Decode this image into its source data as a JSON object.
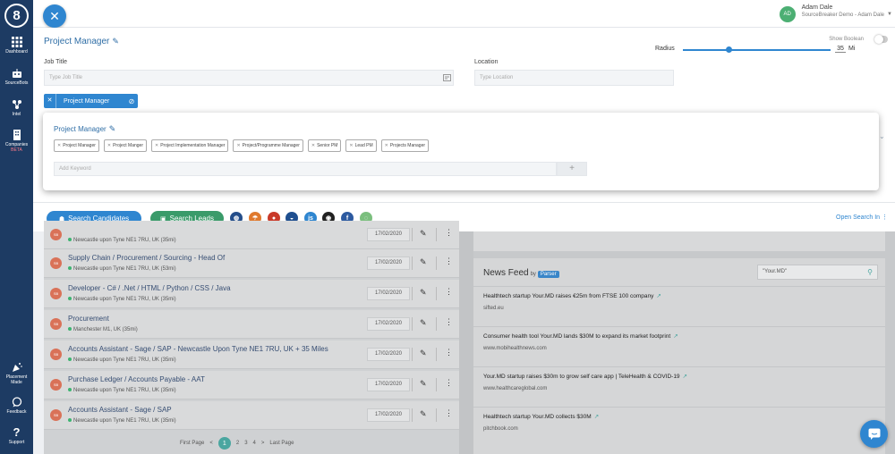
{
  "sidebar": {
    "logo": "8",
    "items": [
      {
        "label": "Dashboard",
        "icon": "grid-icon"
      },
      {
        "label": "SourceBots",
        "icon": "bot-icon"
      },
      {
        "label": "Intel",
        "icon": "intel-icon"
      },
      {
        "label": "Companies",
        "sub": "BETA",
        "icon": "building-icon"
      },
      {
        "label": "Placement Made",
        "icon": "party-icon"
      },
      {
        "label": "Feedback",
        "icon": "chat-icon"
      },
      {
        "label": "Support",
        "icon": "question-icon"
      }
    ]
  },
  "header": {
    "close_icon": "close-icon",
    "user": {
      "initials": "AD",
      "name": "Adam Dale",
      "sub": "SourceBreaker Demo - Adam Dale"
    }
  },
  "search": {
    "title": "Project Manager",
    "show_boolean": "Show Boolean",
    "job_title_label": "Job Title",
    "job_title_placeholder": "Type Job Title",
    "location_label": "Location",
    "location_placeholder": "Type Location",
    "radius_label": "Radius",
    "radius_value": "35",
    "radius_unit": "Mi",
    "radius_fraction": 0.31,
    "chip": "Project Manager"
  },
  "popup": {
    "title": "Project Manager",
    "synonyms": [
      "Project Manager",
      "Project Manger",
      "Project Implementation Manager",
      "Project/Programme Manager",
      "Senior PM",
      "Lead PM",
      "Projects Manager"
    ],
    "keyword_placeholder": "Add Keyword",
    "add_label": "+"
  },
  "actions": {
    "search_candidates": "Search Candidates",
    "search_leads": "Search Leads",
    "open_search": "Open Search In"
  },
  "results": [
    {
      "title": "",
      "location": "Newcastle upon Tyne NE1 7RU, UK (35mi)",
      "date": "17/02/2020"
    },
    {
      "title": "Supply Chain / Procurement / Sourcing - Head Of",
      "location": "Newcastle upon Tyne NE1 7RU, UK (53mi)",
      "date": "17/02/2020"
    },
    {
      "title": "Developer - C# / .Net / HTML / Python / CSS / Java",
      "location": "Newcastle upon Tyne NE1 7RU, UK (35mi)",
      "date": "17/02/2020"
    },
    {
      "title": "Procurement",
      "location": "Manchester M1, UK (35mi)",
      "date": "17/02/2020"
    },
    {
      "title": "Accounts Assistant - Sage / SAP - Newcastle Upon Tyne NE1 7RU, UK + 35 Miles",
      "location": "Newcastle upon Tyne NE1 7RU, UK (35mi)",
      "date": "17/02/2020"
    },
    {
      "title": "Purchase Ledger / Accounts Payable - AAT",
      "location": "Newcastle upon Tyne NE1 7RU, UK (35mi)",
      "date": "17/02/2020"
    },
    {
      "title": "Accounts Assistant - Sage / SAP",
      "location": "Newcastle upon Tyne NE1 7RU, UK (35mi)",
      "date": "17/02/2020"
    }
  ],
  "pagination": {
    "first": "First Page",
    "prev": "<",
    "pages": [
      "1",
      "2",
      "3",
      "4"
    ],
    "next": ">",
    "last": "Last Page"
  },
  "news": {
    "title": "News Feed",
    "by": "by",
    "provider": "Parser",
    "search_value": "\"Your.MD\"",
    "items": [
      {
        "headline": "Healthtech startup Your.MD raises €25m from FTSE 100 company",
        "source": "sifted.eu"
      },
      {
        "headline": "Consumer health tool Your.MD lands $30M to expand its market footprint",
        "source": "www.mobihealthnews.com"
      },
      {
        "headline": "Your.MD startup raises $30m to grow self care app | TeleHealth & COVID-19",
        "source": "www.healthcareglobal.com"
      },
      {
        "headline": "Healthtech startup Your.MD collects $30M",
        "source": "pitchbook.com"
      }
    ]
  },
  "colors": {
    "primary": "#2f86d0",
    "green": "#3a9b6a",
    "sidebar": "#1d3b63",
    "avatar": "#d97258"
  }
}
